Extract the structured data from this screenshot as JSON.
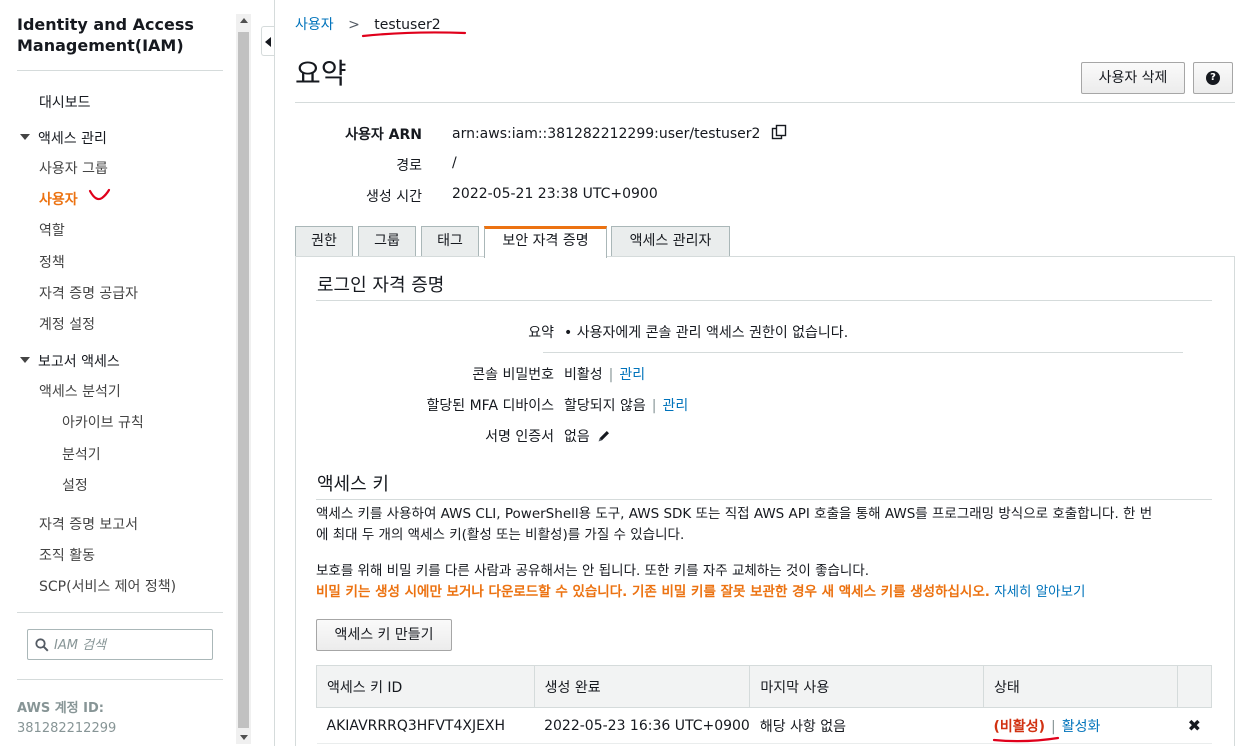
{
  "sidebar": {
    "title": "Identity and Access Management(IAM)",
    "dashboard": "대시보드",
    "access_mgmt": {
      "label": "액세스 관리",
      "items": [
        "사용자 그룹",
        "사용자",
        "역할",
        "정책",
        "자격 증명 공급자",
        "계정 설정"
      ]
    },
    "reports": {
      "label": "보고서 액세스",
      "analyzer": "액세스 분석기",
      "sub_items": [
        "아카이브 규칙",
        "분석기",
        "설정"
      ],
      "items": [
        "자격 증명 보고서",
        "조직 활동",
        "SCP(서비스 제어 정책)"
      ]
    },
    "search_placeholder": "IAM 검색",
    "account_label": "AWS 계정 ID:",
    "account_id": "381282212299"
  },
  "breadcrumb": {
    "parent": "사용자",
    "separator": ">",
    "current": "testuser2"
  },
  "page": {
    "title": "요약",
    "delete_button": "사용자 삭제",
    "help_glyph": "?"
  },
  "summary": {
    "arn_label": "사용자 ARN",
    "arn_value": "arn:aws:iam::381282212299:user/testuser2",
    "path_label": "경로",
    "path_value": "/",
    "created_label": "생성 시간",
    "created_value": "2022-05-21 23:38 UTC+0900"
  },
  "tabs": [
    "권한",
    "그룹",
    "태그",
    "보안 자격 증명",
    "액세스 관리자"
  ],
  "login": {
    "title": "로그인 자격 증명",
    "summary_label": "요약",
    "summary_value": "사용자에게 콘솔 관리 액세스 권한이 없습니다.",
    "console_pw_label": "콘솔 비밀번호",
    "console_pw_value": "비활성",
    "console_pw_link": "관리",
    "mfa_label": "할당된 MFA 디바이스",
    "mfa_value": "할당되지 않음",
    "mfa_link": "관리",
    "cert_label": "서명 인증서",
    "cert_value": "없음"
  },
  "access_keys": {
    "title": "액세스 키",
    "desc_line1": "액세스 키를 사용하여 AWS CLI, PowerShell용 도구, AWS SDK 또는 직접 AWS API 호출을 통해 AWS를 프로그래밍 방식으로 호출합니다. 한 번",
    "desc_line2": "에 최대 두 개의 액세스 키(활성 또는 비활성)를 가질 수 있습니다.",
    "note": "보호를 위해 비밀 키를 다른 사람과 공유해서는 안 됩니다. 또한 키를 자주 교체하는 것이 좋습니다.",
    "warning": "비밀 키는 생성 시에만 보거나 다운로드할 수 있습니다. 기존 비밀 키를 잘못 보관한 경우 새 액세스 키를 생성하십시오.",
    "learn_more": "자세히 알아보기",
    "create_button": "액세스 키 만들기",
    "columns": [
      "액세스 키 ID",
      "생성 완료",
      "마지막 사용",
      "상태"
    ],
    "rows": [
      {
        "id": "AKIAVRRRQ3HFVT4XJEXH",
        "created": "2022-05-23 16:36 UTC+0900",
        "last_used": "해당 사항 없음",
        "status": "(비활성)",
        "action": "활성화",
        "delete_glyph": "✖"
      }
    ]
  },
  "colors": {
    "accent": "#ec7211",
    "link": "#0073bb",
    "inactive": "#d13212",
    "annotation": "#e0001b"
  }
}
